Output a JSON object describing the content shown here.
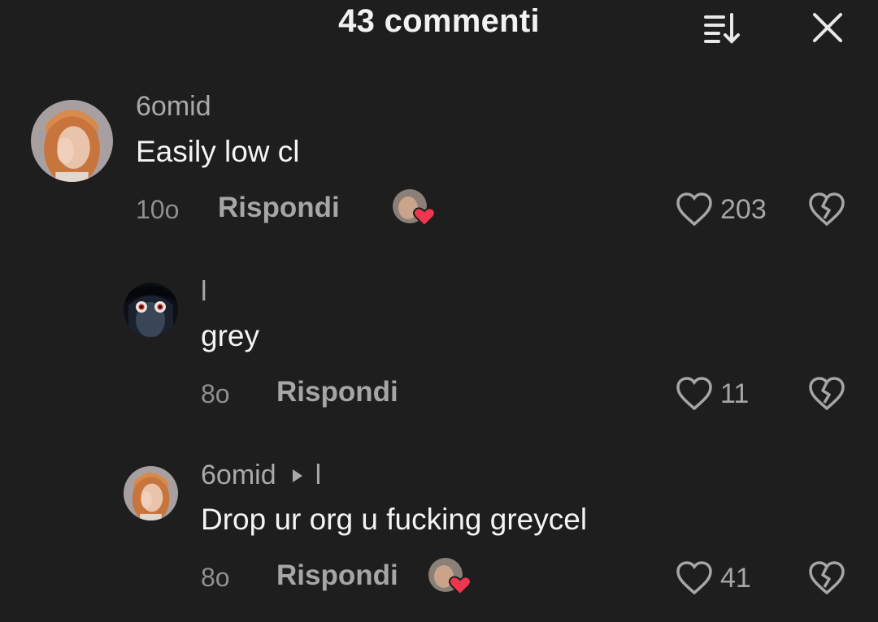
{
  "header": {
    "title": "43 commenti"
  },
  "comments": [
    {
      "username": "6omid",
      "text": "Easily low cl",
      "time": "10o",
      "reply_label": "Rispondi",
      "likes": "203",
      "liked_by_creator": true
    },
    {
      "username": "l",
      "text": "grey",
      "time": "8o",
      "reply_label": "Rispondi",
      "likes": "11",
      "liked_by_creator": false
    },
    {
      "username": "6omid",
      "reply_to": "l",
      "text": "Drop ur org u fucking greycel",
      "time": "8o",
      "reply_label": "Rispondi",
      "likes": "41",
      "liked_by_creator": true
    }
  ],
  "colors": {
    "background": "#1e1e1e",
    "text_primary": "#f4f4f4",
    "text_secondary": "#a6a6a6",
    "heart_red": "#f0364f"
  },
  "icons": {
    "sort": "sort-icon",
    "close": "close-icon",
    "like": "heart-outline-icon",
    "dislike": "broken-heart-icon"
  }
}
